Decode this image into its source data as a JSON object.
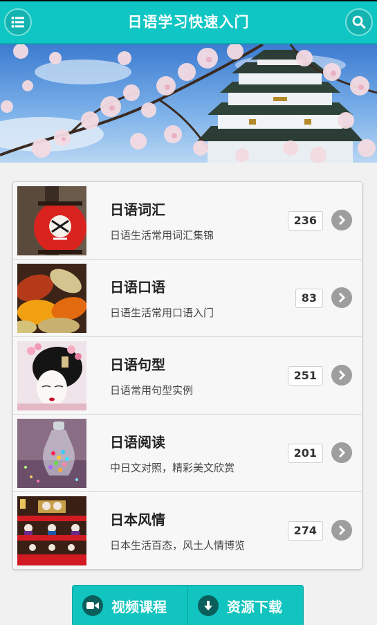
{
  "header": {
    "title": "日语学习快速入门",
    "menu_icon": "list-icon",
    "search_icon": "search-icon"
  },
  "items": [
    {
      "title": "日语词汇",
      "subtitle": "日语生活常用词汇集锦",
      "count": "236",
      "thumb": "red-lantern"
    },
    {
      "title": "日语口语",
      "subtitle": "日语生活常用口语入门",
      "count": "83",
      "thumb": "autumn-leaves"
    },
    {
      "title": "日语句型",
      "subtitle": "日语常用句型实例",
      "count": "251",
      "thumb": "geisha"
    },
    {
      "title": "日语阅读",
      "subtitle": "中日文对照，精彩美文欣赏",
      "count": "201",
      "thumb": "candy-jar"
    },
    {
      "title": "日本风情",
      "subtitle": "日本生活百态，风土人情博览",
      "count": "274",
      "thumb": "hina-dolls"
    }
  ],
  "footer": {
    "video_label": "视频课程",
    "download_label": "资源下载"
  },
  "colors": {
    "accent": "#0fc6c4",
    "arrow": "#9e9e9e"
  }
}
